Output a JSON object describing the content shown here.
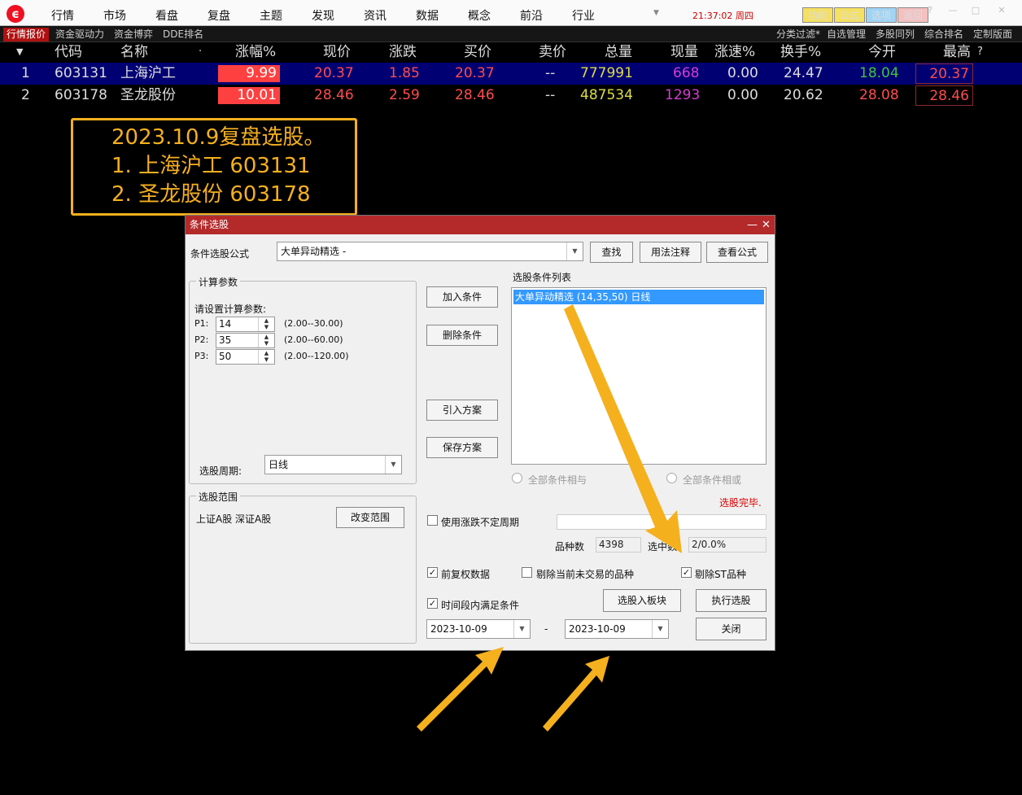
{
  "menu": {
    "items": [
      "行情",
      "市场",
      "看盘",
      "复盘",
      "主题",
      "发现",
      "资讯",
      "数据",
      "概念",
      "前沿",
      "行业"
    ],
    "dropdown_icon": "▼",
    "time": "21:37:02 周四",
    "buttons": [
      "功能",
      "公式",
      "选项",
      "返回"
    ],
    "win_controls": [
      "?",
      "—",
      "□",
      "✕"
    ]
  },
  "tabs": {
    "left": [
      "行情报价",
      "资金驱动力",
      "资金博弈",
      "DDE排名"
    ],
    "right": [
      "分类过滤*",
      "自选管理",
      "多股同列",
      "综合排名",
      "定制版面"
    ]
  },
  "table": {
    "headers": {
      "dropdown": "▼",
      "code": "代码",
      "name": "名称",
      "dot": "·",
      "pct": "涨幅%",
      "price": "现价",
      "chg": "涨跌",
      "bid": "买价",
      "ask": "卖价",
      "vol": "总量",
      "curvol": "现量",
      "speed": "涨速%",
      "turnover": "换手%",
      "open": "今开",
      "high": "最高",
      "help": "?"
    },
    "rows": [
      {
        "idx": "1",
        "code": "603131",
        "name": "上海沪工",
        "pct": "9.99",
        "price": "20.37",
        "chg": "1.85",
        "bid": "20.37",
        "ask": "--",
        "vol": "777991",
        "curvol": "668",
        "speed": "0.00",
        "turnover": "24.47",
        "open": "18.04",
        "high": "20.37"
      },
      {
        "idx": "2",
        "code": "603178",
        "name": "圣龙股份",
        "pct": "10.01",
        "price": "28.46",
        "chg": "2.59",
        "bid": "28.46",
        "ask": "--",
        "vol": "487534",
        "curvol": "1293",
        "speed": "0.00",
        "turnover": "20.62",
        "open": "28.08",
        "high": "28.46"
      }
    ]
  },
  "annotation": {
    "lines": [
      "2023.10.9复盘选股。",
      "1. 上海沪工 603131",
      "2. 圣龙股份 603178"
    ]
  },
  "dialog": {
    "title": "条件选股",
    "title_controls": [
      "—",
      "✕"
    ],
    "formula_label": "条件选股公式",
    "formula_value": "大单异动精选 -",
    "find_btn": "查找",
    "usage_btn": "用法注释",
    "view_btn": "查看公式",
    "calc_group": "计算参数",
    "calc_prompt": "请设置计算参数:",
    "params": [
      {
        "label": "P1:",
        "value": "14",
        "range": "(2.00--30.00)"
      },
      {
        "label": "P2:",
        "value": "35",
        "range": "(2.00--60.00)"
      },
      {
        "label": "P3:",
        "value": "50",
        "range": "(2.00--120.00)"
      }
    ],
    "period_label": "选股周期:",
    "period_value": "日线",
    "range_group": "选股范围",
    "range_text": "上证A股 深证A股",
    "change_range_btn": "改变范围",
    "add_cond_btn": "加入条件",
    "del_cond_btn": "删除条件",
    "import_btn": "引入方案",
    "save_btn": "保存方案",
    "cond_list_title": "选股条件列表",
    "cond_item": "大单异动精选 (14,35,50) 日线",
    "radio_and": "全部条件相与",
    "radio_or": "全部条件相或",
    "status": "选股完毕.",
    "use_period_label": "使用涨跌不定周期",
    "count_label": "品种数",
    "count_value": "4398",
    "selected_label": "选中数",
    "selected_value": "2/0.0%",
    "prefix_label": "前复权数据",
    "exclude_untraded_label": "剔除当前未交易的品种",
    "exclude_st_label": "剔除ST品种",
    "time_range_label": "时间段内满足条件",
    "to_block_btn": "选股入板块",
    "run_btn": "执行选股",
    "close_btn": "关闭",
    "date_from": "2023-10-09",
    "date_sep": "-",
    "date_to": "2023-10-09"
  },
  "colors": {
    "accent": "#f5b01e",
    "title_bar": "#b42a2a",
    "up": "#ff4d4d"
  }
}
